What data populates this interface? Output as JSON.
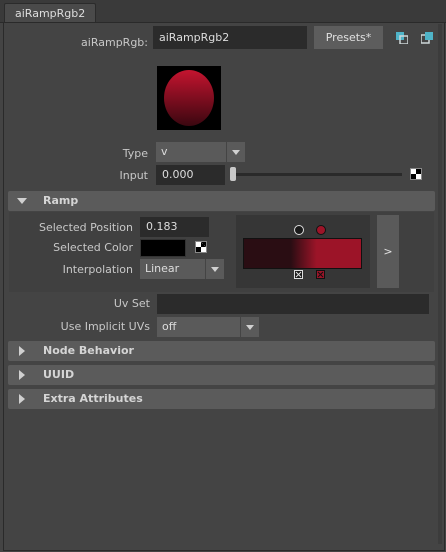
{
  "tab": {
    "label": "aiRampRgb2"
  },
  "node": {
    "label": "aiRampRgb:",
    "value": "aiRampRgb2",
    "presets_label": "Presets*"
  },
  "swatch": {
    "color_top": "#c2142e",
    "color_bottom": "#3c0610"
  },
  "type": {
    "label": "Type",
    "value": "v"
  },
  "input": {
    "label": "Input",
    "value": "0.000",
    "slider_fraction": 0.0
  },
  "ramp": {
    "title": "Ramp",
    "selected_position_label": "Selected Position",
    "selected_position_value": "0.183",
    "selected_color_label": "Selected Color",
    "selected_color": "#000000",
    "interpolation_label": "Interpolation",
    "interpolation_value": "Linear",
    "expand_label": ">",
    "gradient_start": "#2a0d13",
    "gradient_end": "#9c1428"
  },
  "uv_set": {
    "label": "Uv Set",
    "value": ""
  },
  "use_implicit_uvs": {
    "label": "Use Implicit UVs",
    "value": "off"
  },
  "sections": {
    "node_behavior": "Node Behavior",
    "uuid": "UUID",
    "extra_attributes": "Extra Attributes"
  },
  "colors": {
    "accent_teal": "#4fb4c8",
    "panel_bg": "#444444",
    "field_bg": "#2b2b2b"
  }
}
